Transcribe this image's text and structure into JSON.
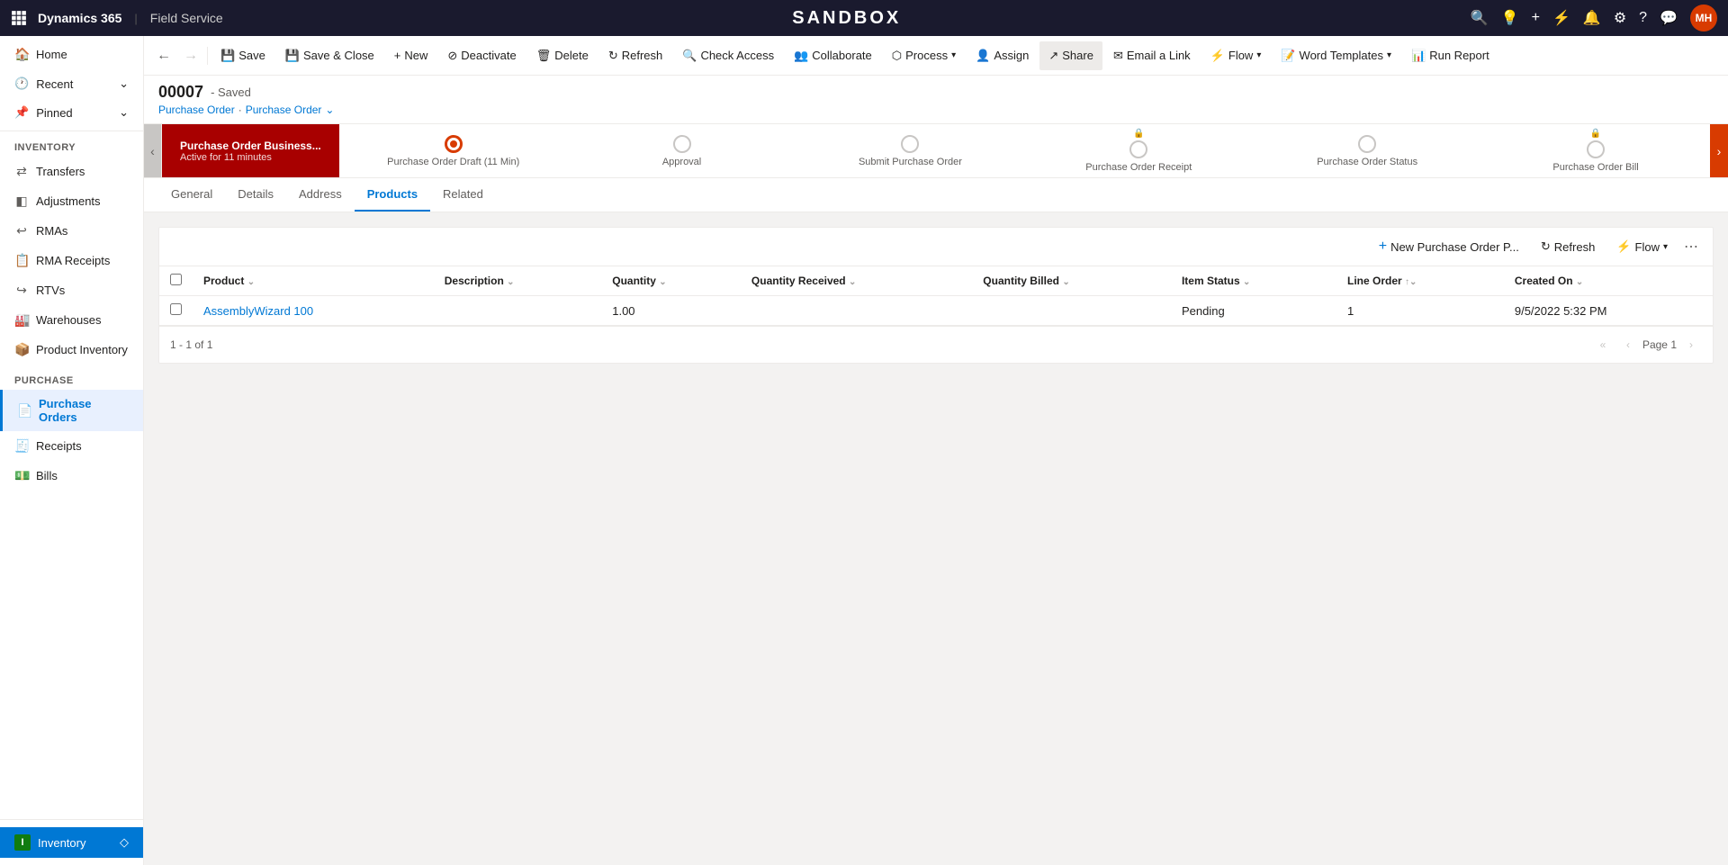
{
  "app": {
    "brand": "Dynamics 365",
    "separator": "|",
    "module": "Field Service",
    "title": "SANDBOX"
  },
  "topnav": {
    "search_icon": "🔍",
    "question_icon": "?",
    "plus_icon": "+",
    "filter_icon": "≡",
    "bell_icon": "🔔",
    "gear_icon": "⚙",
    "help_icon": "?",
    "chat_icon": "💬",
    "avatar_label": "MH"
  },
  "commandbar": {
    "back_label": "←",
    "forward_label": "→",
    "save_label": "Save",
    "save_close_label": "Save & Close",
    "new_label": "New",
    "deactivate_label": "Deactivate",
    "delete_label": "Delete",
    "refresh_label": "Refresh",
    "check_access_label": "Check Access",
    "collaborate_label": "Collaborate",
    "process_label": "Process",
    "assign_label": "Assign",
    "share_label": "Share",
    "email_link_label": "Email a Link",
    "flow_label": "Flow",
    "word_templates_label": "Word Templates",
    "run_report_label": "Run Report"
  },
  "record": {
    "id": "00007",
    "status": "- Saved",
    "breadcrumb1": "Purchase Order",
    "breadcrumb_sep": "·",
    "breadcrumb2": "Purchase Order",
    "breadcrumb_chevron": "⌄"
  },
  "process_flow": {
    "left_arrow": "‹",
    "right_arrow": "›",
    "active_step": {
      "name": "Purchase Order Business...",
      "subtitle": "Active for 11 minutes"
    },
    "steps": [
      {
        "label": "Purchase Order Draft  (11 Min)",
        "status": "active_circle",
        "lock": ""
      },
      {
        "label": "Approval",
        "status": "empty",
        "lock": ""
      },
      {
        "label": "Submit Purchase Order",
        "status": "empty",
        "lock": ""
      },
      {
        "label": "Purchase Order Receipt",
        "status": "empty",
        "lock": "🔒"
      },
      {
        "label": "Purchase Order Status",
        "status": "empty",
        "lock": ""
      },
      {
        "label": "Purchase Order Bill",
        "status": "empty",
        "lock": "🔒"
      }
    ]
  },
  "tabs": [
    {
      "label": "General",
      "active": false
    },
    {
      "label": "Details",
      "active": false
    },
    {
      "label": "Address",
      "active": false
    },
    {
      "label": "Products",
      "active": true
    },
    {
      "label": "Related",
      "active": false
    }
  ],
  "subgrid": {
    "new_btn_label": "New Purchase Order P...",
    "refresh_label": "Refresh",
    "flow_label": "Flow",
    "more_icon": "⋯",
    "columns": [
      {
        "label": "Product",
        "sortable": true
      },
      {
        "label": "Description",
        "sortable": true
      },
      {
        "label": "Quantity",
        "sortable": true
      },
      {
        "label": "Quantity Received",
        "sortable": true
      },
      {
        "label": "Quantity Billed",
        "sortable": true
      },
      {
        "label": "Item Status",
        "sortable": true
      },
      {
        "label": "Line Order",
        "sortable": true,
        "sort_dir": "asc"
      },
      {
        "label": "Created On",
        "sortable": true
      }
    ],
    "rows": [
      {
        "product": "AssemblyWizard 100",
        "description": "",
        "quantity": "1.00",
        "quantity_received": "",
        "quantity_billed": "",
        "item_status": "Pending",
        "line_order": "1",
        "created_on": "9/5/2022 5:32 PM"
      }
    ],
    "pagination": {
      "info": "1 - 1 of 1",
      "page_label": "Page 1",
      "first_icon": "«",
      "prev_icon": "‹",
      "next_icon": "›"
    }
  },
  "sidebar": {
    "sections": [
      {
        "label": "Inventory",
        "items": [
          {
            "label": "Transfers",
            "icon": "⇄"
          },
          {
            "label": "Adjustments",
            "icon": "◧"
          },
          {
            "label": "RMAs",
            "icon": "↩"
          },
          {
            "label": "RMA Receipts",
            "icon": "📋"
          },
          {
            "label": "RTVs",
            "icon": "↪"
          },
          {
            "label": "Warehouses",
            "icon": "🏭"
          },
          {
            "label": "Product Inventory",
            "icon": "📦"
          }
        ]
      },
      {
        "label": "Purchase",
        "items": [
          {
            "label": "Purchase Orders",
            "icon": "📄",
            "active": true
          },
          {
            "label": "Receipts",
            "icon": "🧾"
          },
          {
            "label": "Bills",
            "icon": "💵"
          }
        ]
      }
    ],
    "top_items": [
      {
        "label": "Home",
        "icon": "🏠"
      },
      {
        "label": "Recent",
        "icon": "🕐",
        "expandable": true
      },
      {
        "label": "Pinned",
        "icon": "📌",
        "expandable": true
      }
    ],
    "footer": {
      "label": "Inventory",
      "icon": "I"
    }
  }
}
